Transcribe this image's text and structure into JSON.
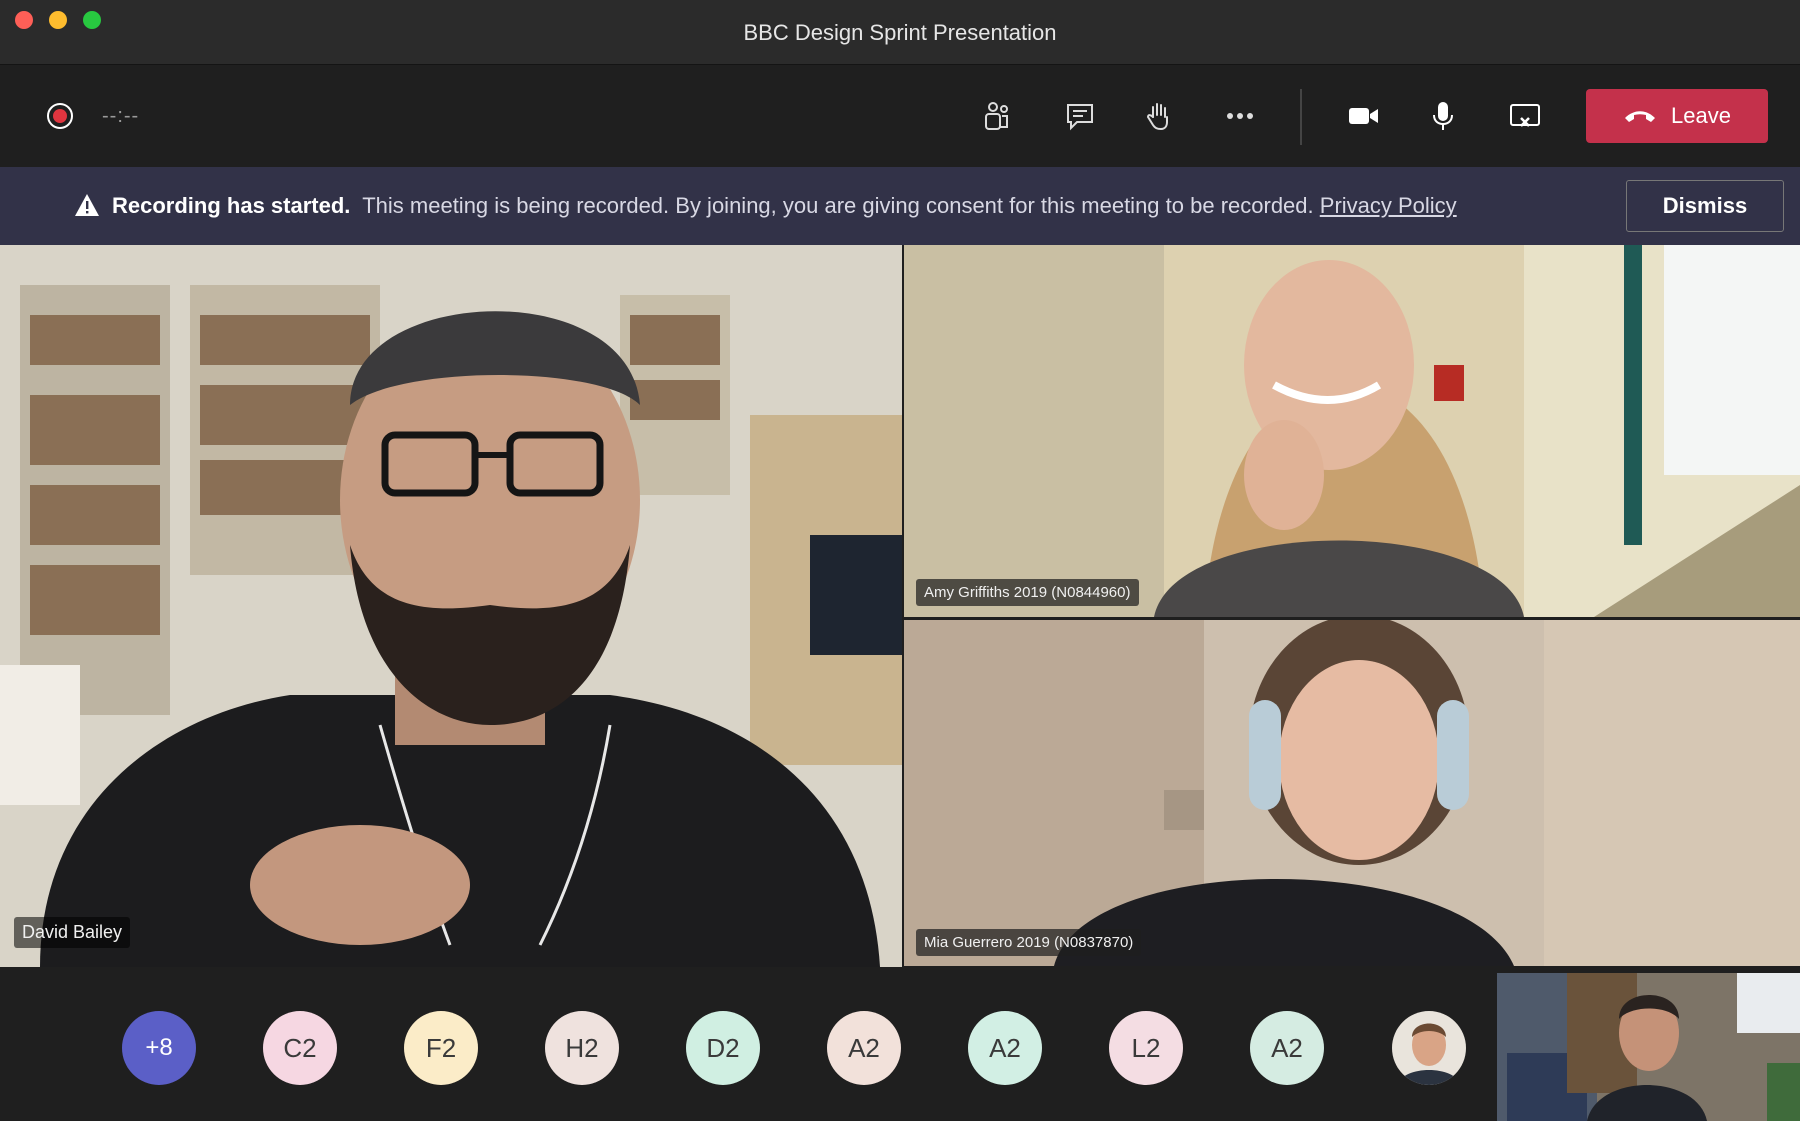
{
  "window": {
    "title": "BBC Design Sprint Presentation"
  },
  "toolbar": {
    "timer": "--:--",
    "leave_label": "Leave",
    "buttons": [
      "participants-icon",
      "chat-icon",
      "raise-hand-icon",
      "more-icon",
      "camera-icon",
      "microphone-icon",
      "stop-share-icon"
    ]
  },
  "banner": {
    "title": "Recording has started.",
    "message": "This meeting is being recorded. By joining, you are giving consent for this meeting to be recorded.",
    "link": "Privacy Policy",
    "dismiss": "Dismiss"
  },
  "participants": {
    "main": "David Bailey",
    "top_right": "Amy Griffiths 2019 (N0844960)",
    "bottom_right": "Mia Guerrero 2019 (N0837870)"
  },
  "avatars": [
    {
      "label": "+8",
      "color": "#5b5fc7"
    },
    {
      "label": "C2",
      "color": "#f6d7e2"
    },
    {
      "label": "F2",
      "color": "#fbecc8"
    },
    {
      "label": "H2",
      "color": "#efe2de"
    },
    {
      "label": "D2",
      "color": "#d0efe2"
    },
    {
      "label": "A2",
      "color": "#f2e1da"
    },
    {
      "label": "A2",
      "color": "#d2efe4"
    },
    {
      "label": "L2",
      "color": "#f4dde3"
    },
    {
      "label": "A2",
      "color": "#d5ece2"
    }
  ],
  "colors": {
    "leave": "#c4314b",
    "banner": "#323248",
    "record": "#e0353f"
  }
}
